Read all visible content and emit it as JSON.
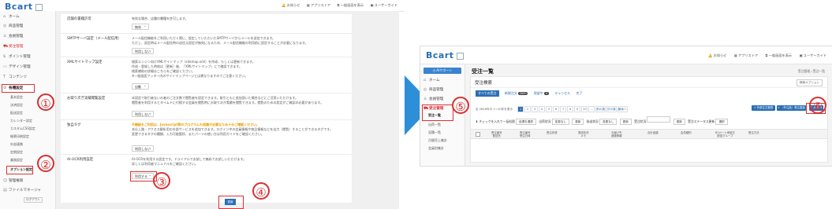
{
  "left": {
    "logo": "Bcart",
    "toplinks": [
      "お知らせ",
      "アプリストア",
      "一般画面を表示",
      "ユーザーガイド"
    ],
    "sidebar": [
      {
        "icon": "home-icon",
        "glyph": "⌂",
        "label": "ホーム"
      },
      {
        "icon": "products-icon",
        "glyph": "◎",
        "label": "商品管理"
      },
      {
        "icon": "members-icon",
        "glyph": "♙",
        "label": "会員管理"
      },
      {
        "icon": "orders-icon",
        "glyph": "🛒",
        "label": "受注管理"
      },
      {
        "icon": "points-icon",
        "glyph": "$",
        "label": "ポイント管理"
      },
      {
        "icon": "design-icon",
        "glyph": "▭",
        "label": "デザイン管理"
      },
      {
        "icon": "contents-icon",
        "glyph": "T",
        "label": "コンテンツ"
      },
      {
        "icon": "settings-icon",
        "glyph": "⚙",
        "label": "各種設定"
      }
    ],
    "sidebar_sub": [
      "基本設定",
      "決済設定",
      "配送設定",
      "カレンダー設定",
      "カスタムCSS設定",
      "帳票印刷設定",
      "外部連携",
      "定期設定",
      "業務設定"
    ],
    "sidebar_option": "オプション設定",
    "sidebar_bottom": [
      {
        "icon": "admin-icon",
        "glyph": "☺",
        "label": "管理権限"
      },
      {
        "icon": "file-icon",
        "glyph": "▤",
        "label": "ファイルマネージャ"
      }
    ],
    "logout": "ログアウト",
    "rows": [
      {
        "label": "店舗の書籍許可",
        "desc": [
          "有効な場合、店舗の書籍を許可します。"
        ],
        "select": "無効"
      },
      {
        "label": "SMTPサーバ設定（メール配信用）",
        "desc": [
          "メール配信機能をご利用いただく際に、設定していただいたSMTPサーバからメールを送信できます。",
          "ただし、設定時はメール配信時の送信元設定が無効になるため、メール配信機能の利用前に設定することが必要になります。"
        ],
        "select": "利用しない"
      },
      {
        "label": "XMLサイトマップ設定",
        "desc": [
          "検索エンジン向けXMLサイトマップ（sitemap.xml）を作成、もしくは更新できます。",
          "作成・登録した時刻は［更新］後、「XMLサイトマップ」にて確認できます。",
          "検索補助の詳細はこちらをご確認ください。",
          "※一般画面フッター内のサイトマップページとは異なりますのでご注意ください。"
        ],
        "select": "自動"
      },
      {
        "label": "お取り次ぎ実績閲覧設定",
        "desc": [
          "本設定で取引者ないの者のご注文数で閲覧者を設定できます。取引ともに追加頂いた場合などにご活用いただけます。",
          "閲覧者を利用するとタイムドに付随する会員を閲覧時にお取り次ぎ実績を閲覧できます。閲覧のための設定がご確認の必要があります。"
        ],
        "select": "利用しない"
      },
      {
        "label": "独自タグ",
        "warn": "※機能をご利用は、Javascript等のプログラムも知識が必要なため十分ご確認ください。",
        "desc": [
          "本仕上路・アクセス解析用の外部サービスを追加できます。ログイン中の会員情報や商品情報などを出力（閲覧）することができるタグです。",
          "変更できるタグの種類、入力可能箇所、またパーツの使い方は利用ガイドをご確認ください。"
        ],
        "select": "利用しない"
      },
      {
        "label": "AI-OCR利用設定",
        "desc": [
          "AI-OCRを利用する設定です。ドライアルでお試しで無料でお試しいただけます。",
          "詳しくは利用者マニュアルをご確認ください。"
        ],
        "select": "利用する"
      }
    ],
    "update_button": "更新",
    "markers": [
      "①",
      "②",
      "③",
      "④"
    ]
  },
  "right": {
    "logo": "Bcart",
    "toplinks": [
      "お知らせ",
      "アプリストア",
      "一般画面を表示",
      "ユーザーガイド"
    ],
    "ai_button": "AIサポート",
    "sidebar": [
      {
        "icon": "home-icon",
        "glyph": "⌂",
        "label": "ホーム"
      },
      {
        "icon": "products-icon",
        "glyph": "◎",
        "label": "商品管理"
      },
      {
        "icon": "members-icon",
        "glyph": "♙",
        "label": "会員管理"
      },
      {
        "icon": "orders-icon",
        "glyph": "🛒",
        "label": "受注管理"
      }
    ],
    "sidebar_sub": [
      "受注一覧",
      "出荷一覧",
      "見積一覧",
      "月間売上集計",
      "会員別集計"
    ],
    "page_title": "受注一覧",
    "breadcrumb": "受注管理 / 受注一覧",
    "card_title": "受注検索",
    "search_option": "検索オプション",
    "tabs": [
      {
        "label": "すべての受注",
        "active": true
      },
      {
        "label": "新規注文",
        "badge": "2600"
      },
      {
        "label": "保留中",
        "badge": "4"
      },
      {
        "label": "キャンセル"
      },
      {
        "label": "完了"
      }
    ],
    "pager_info": "全 2626件中 1〜20件を表示",
    "pages": [
      "1",
      "2",
      "3",
      "4",
      "5",
      "6",
      "7",
      "8",
      "9",
      "10",
      "…",
      "前の頁",
      "次の頁",
      "最後へ"
    ],
    "buttons": [
      "外部注文登録",
      "（外注品）受注直接登録",
      "AI-OCR"
    ],
    "filter": {
      "bulk_label": "チェックを入れて一括処理",
      "bulk_select": "処理を選択",
      "shipping_label": "出荷状況",
      "shipping_select": "変更なし",
      "update1": "更新",
      "payment_label": "発送状況",
      "payment_select": "変更なし",
      "update2": "更新",
      "memo_label": "受注状況",
      "update3": "更新",
      "status_label": "受注ステータス更新",
      "status_select": "選択"
    },
    "columns": [
      "受注番号\n配送先",
      "受注番号\n受注日時",
      "受注状態",
      "発送状況\nメモ",
      "お届け先\n連絡情報",
      "合計金額",
      "会員種別",
      "B2カート承認日\n配送グループ",
      "受注方法"
    ],
    "markers": [
      "⑤",
      "⑥"
    ]
  },
  "colors": {
    "accent": "#2a6fb5",
    "highlight": "#e03030",
    "arrow": "#2d8fd8"
  }
}
